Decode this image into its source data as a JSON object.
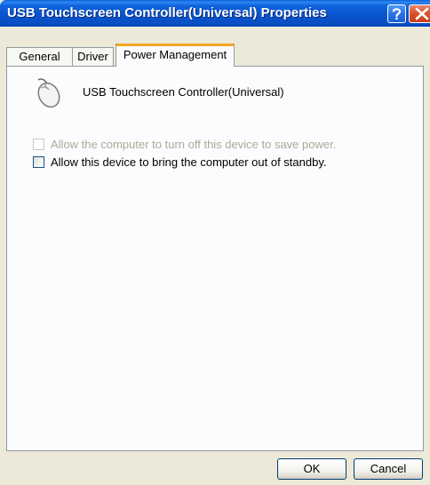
{
  "window": {
    "title": "USB Touchscreen Controller(Universal) Properties",
    "help_icon": "question-mark",
    "close_icon": "x-mark"
  },
  "tabs": [
    {
      "label": "General",
      "active": false
    },
    {
      "label": "Driver",
      "active": false
    },
    {
      "label": "Power Management",
      "active": true
    }
  ],
  "device": {
    "icon": "mouse-icon",
    "name": "USB Touchscreen Controller(Universal)"
  },
  "options": [
    {
      "label": "Allow the computer to turn off this device to save power.",
      "checked": false,
      "enabled": false
    },
    {
      "label": "Allow this device to bring the computer out of standby.",
      "checked": false,
      "enabled": true
    }
  ],
  "buttons": {
    "ok_label": "OK",
    "cancel_label": "Cancel"
  },
  "colors": {
    "titlebar": "#0853cd",
    "tab_accent": "#f4a524",
    "dialog_bg": "#ece9d8"
  }
}
